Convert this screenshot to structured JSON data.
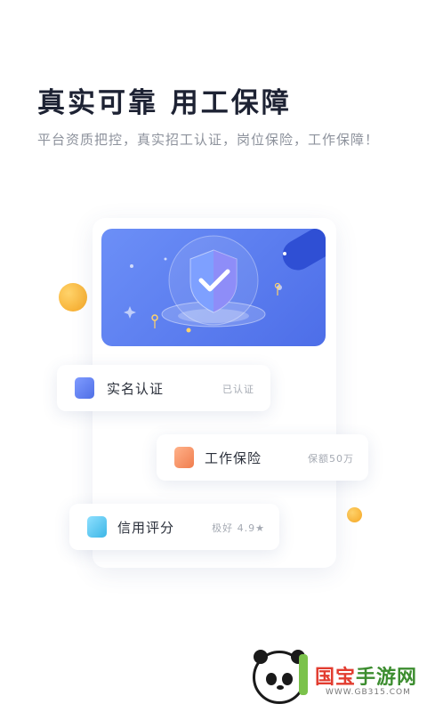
{
  "header": {
    "title": "真实可靠 用工保障",
    "subtitle": "平台资质把控，真实招工认证，岗位保险，工作保障！"
  },
  "items": [
    {
      "label": "实名认证",
      "value": "已认证"
    },
    {
      "label": "工作保险",
      "value": "保额50万"
    },
    {
      "label": "信用评分",
      "value": "极好 4.9★"
    }
  ],
  "icons": {
    "banner": "shield-check-icon",
    "item1": "id-card-icon",
    "item2": "insurance-badge-icon",
    "item3": "credit-badge-icon"
  },
  "colors": {
    "banner": "#5a7cf0",
    "accent_dot": "#f5a623",
    "title": "#1d2233"
  },
  "watermark": {
    "name_part1": "国宝",
    "name_part2": "手游网",
    "url": "WWW.GB315.COM"
  }
}
